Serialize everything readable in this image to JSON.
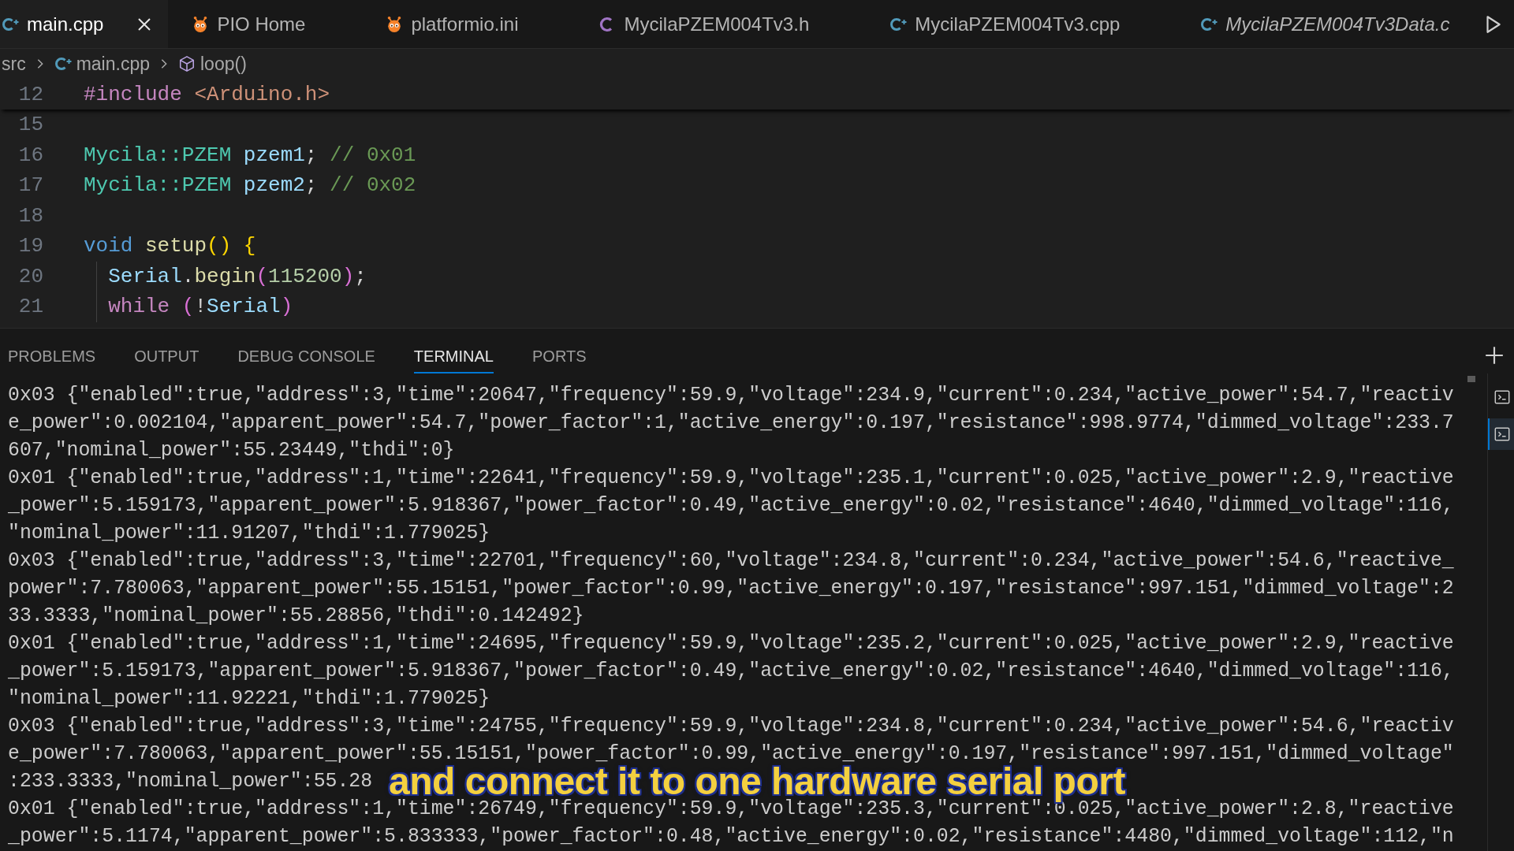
{
  "tabs": [
    {
      "label": "main.cpp",
      "kind": "cpp",
      "selected": true,
      "preview": false
    },
    {
      "label": "PIO Home",
      "kind": "platformio",
      "selected": false,
      "preview": false
    },
    {
      "label": "platformio.ini",
      "kind": "platformio",
      "selected": false,
      "preview": false
    },
    {
      "label": "MycilaPZEM004Tv3.h",
      "kind": "header",
      "selected": false,
      "preview": false
    },
    {
      "label": "MycilaPZEM004Tv3.cpp",
      "kind": "cpp",
      "selected": false,
      "preview": false
    },
    {
      "label": "MycilaPZEM004Tv3Data.c",
      "kind": "cpp",
      "selected": false,
      "preview": true
    }
  ],
  "breadcrumb": [
    {
      "label": "src",
      "kind": "folder"
    },
    {
      "label": "main.cpp",
      "kind": "file"
    },
    {
      "label": "loop()",
      "kind": "symbol"
    }
  ],
  "editor": {
    "sticky_line": {
      "number": "12",
      "tokens": [
        {
          "text": "#include ",
          "kind": "preprocessor"
        },
        {
          "text": "<Arduino.h>",
          "kind": "string"
        }
      ]
    },
    "lines": [
      {
        "number": "15"
      },
      {
        "number": "16",
        "tokens": [
          {
            "text": "Mycila::PZEM ",
            "kind": "type"
          },
          {
            "text": "pzem1",
            "kind": "variable"
          },
          {
            "text": "; ",
            "kind": "punctuation"
          },
          {
            "text": "// 0x01",
            "kind": "comment"
          }
        ]
      },
      {
        "number": "17",
        "tokens": [
          {
            "text": "Mycila::PZEM ",
            "kind": "type"
          },
          {
            "text": "pzem2",
            "kind": "variable"
          },
          {
            "text": "; ",
            "kind": "punctuation"
          },
          {
            "text": "// 0x02",
            "kind": "comment"
          }
        ]
      },
      {
        "number": "18"
      },
      {
        "number": "19",
        "tokens": [
          {
            "text": "void ",
            "kind": "keyword"
          },
          {
            "text": "setup",
            "kind": "function"
          },
          {
            "text": "() {",
            "kind": "bracket"
          }
        ],
        "children": [
          {
            "number": "20",
            "tokens": [
              {
                "text": "Serial",
                "kind": "variable"
              },
              {
                "text": ".",
                "kind": "punctuation"
              },
              {
                "text": "begin",
                "kind": "function"
              },
              {
                "text": "(",
                "kind": "bracket2"
              },
              {
                "text": "115200",
                "kind": "number"
              },
              {
                "text": ")",
                "kind": "bracket2"
              },
              {
                "text": ";",
                "kind": "punctuation"
              }
            ]
          },
          {
            "number": "21",
            "tokens": [
              {
                "text": "while ",
                "kind": "control"
              },
              {
                "text": "(",
                "kind": "bracket2"
              },
              {
                "text": "!",
                "kind": "punctuation"
              },
              {
                "text": "Serial",
                "kind": "variable"
              },
              {
                "text": ")",
                "kind": "bracket2"
              }
            ]
          }
        ]
      }
    ]
  },
  "panel": {
    "tabs": [
      {
        "label": "PROBLEMS",
        "selected": false
      },
      {
        "label": "OUTPUT",
        "selected": false
      },
      {
        "label": "DEBUG CONSOLE",
        "selected": false
      },
      {
        "label": "TERMINAL",
        "selected": true
      },
      {
        "label": "PORTS",
        "selected": false
      }
    ],
    "terminal_lines": [
      "0x03 {\"enabled\":true,\"address\":3,\"time\":20647,\"frequency\":59.9,\"voltage\":234.9,\"current\":0.234,\"active_power\":54.7,\"reactiv",
      "e_power\":0.002104,\"apparent_power\":54.7,\"power_factor\":1,\"active_energy\":0.197,\"resistance\":998.9774,\"dimmed_voltage\":233.7",
      "607,\"nominal_power\":55.23449,\"thdi\":0}",
      "0x01 {\"enabled\":true,\"address\":1,\"time\":22641,\"frequency\":59.9,\"voltage\":235.1,\"current\":0.025,\"active_power\":2.9,\"reactive",
      "_power\":5.159173,\"apparent_power\":5.918367,\"power_factor\":0.49,\"active_energy\":0.02,\"resistance\":4640,\"dimmed_voltage\":116,",
      "\"nominal_power\":11.91207,\"thdi\":1.779025}",
      "0x03 {\"enabled\":true,\"address\":3,\"time\":22701,\"frequency\":60,\"voltage\":234.8,\"current\":0.234,\"active_power\":54.6,\"reactive_",
      "power\":7.780063,\"apparent_power\":55.15151,\"power_factor\":0.99,\"active_energy\":0.197,\"resistance\":997.151,\"dimmed_voltage\":2",
      "33.3333,\"nominal_power\":55.28856,\"thdi\":0.142492}",
      "0x01 {\"enabled\":true,\"address\":1,\"time\":24695,\"frequency\":59.9,\"voltage\":235.2,\"current\":0.025,\"active_power\":2.9,\"reactive",
      "_power\":5.159173,\"apparent_power\":5.918367,\"power_factor\":0.49,\"active_energy\":0.02,\"resistance\":4640,\"dimmed_voltage\":116,",
      "\"nominal_power\":11.92221,\"thdi\":1.779025}",
      "0x03 {\"enabled\":true,\"address\":3,\"time\":24755,\"frequency\":59.9,\"voltage\":234.8,\"current\":0.234,\"active_power\":54.6,\"reactiv",
      "e_power\":7.780063,\"apparent_power\":55.15151,\"power_factor\":0.99,\"active_energy\":0.197,\"resistance\":997.151,\"dimmed_voltage\"",
      ":233.3333,\"nominal_power\":55.28",
      "0x01 {\"enabled\":true,\"address\":1,\"time\":26749,\"frequency\":59.9,\"voltage\":235.3,\"current\":0.025,\"active_power\":2.8,\"reactive",
      "_power\":5.1174,\"apparent_power\":5.833333,\"power_factor\":0.48,\"active_energy\":0.02,\"resistance\":4480,\"dimmed_voltage\":112,\"n"
    ],
    "terminals": [
      {
        "selected": false
      },
      {
        "selected": true
      }
    ]
  },
  "caption": {
    "text": "and connect it to one hardware serial port"
  }
}
